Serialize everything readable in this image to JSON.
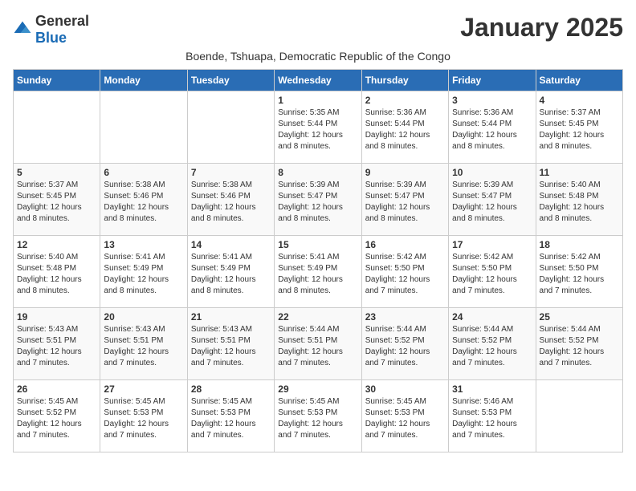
{
  "header": {
    "logo_general": "General",
    "logo_blue": "Blue",
    "month": "January 2025",
    "subtitle": "Boende, Tshuapa, Democratic Republic of the Congo"
  },
  "days_of_week": [
    "Sunday",
    "Monday",
    "Tuesday",
    "Wednesday",
    "Thursday",
    "Friday",
    "Saturday"
  ],
  "weeks": [
    [
      {
        "day": "",
        "info": ""
      },
      {
        "day": "",
        "info": ""
      },
      {
        "day": "",
        "info": ""
      },
      {
        "day": "1",
        "info": "Sunrise: 5:35 AM\nSunset: 5:44 PM\nDaylight: 12 hours\nand 8 minutes."
      },
      {
        "day": "2",
        "info": "Sunrise: 5:36 AM\nSunset: 5:44 PM\nDaylight: 12 hours\nand 8 minutes."
      },
      {
        "day": "3",
        "info": "Sunrise: 5:36 AM\nSunset: 5:44 PM\nDaylight: 12 hours\nand 8 minutes."
      },
      {
        "day": "4",
        "info": "Sunrise: 5:37 AM\nSunset: 5:45 PM\nDaylight: 12 hours\nand 8 minutes."
      }
    ],
    [
      {
        "day": "5",
        "info": "Sunrise: 5:37 AM\nSunset: 5:45 PM\nDaylight: 12 hours\nand 8 minutes."
      },
      {
        "day": "6",
        "info": "Sunrise: 5:38 AM\nSunset: 5:46 PM\nDaylight: 12 hours\nand 8 minutes."
      },
      {
        "day": "7",
        "info": "Sunrise: 5:38 AM\nSunset: 5:46 PM\nDaylight: 12 hours\nand 8 minutes."
      },
      {
        "day": "8",
        "info": "Sunrise: 5:39 AM\nSunset: 5:47 PM\nDaylight: 12 hours\nand 8 minutes."
      },
      {
        "day": "9",
        "info": "Sunrise: 5:39 AM\nSunset: 5:47 PM\nDaylight: 12 hours\nand 8 minutes."
      },
      {
        "day": "10",
        "info": "Sunrise: 5:39 AM\nSunset: 5:47 PM\nDaylight: 12 hours\nand 8 minutes."
      },
      {
        "day": "11",
        "info": "Sunrise: 5:40 AM\nSunset: 5:48 PM\nDaylight: 12 hours\nand 8 minutes."
      }
    ],
    [
      {
        "day": "12",
        "info": "Sunrise: 5:40 AM\nSunset: 5:48 PM\nDaylight: 12 hours\nand 8 minutes."
      },
      {
        "day": "13",
        "info": "Sunrise: 5:41 AM\nSunset: 5:49 PM\nDaylight: 12 hours\nand 8 minutes."
      },
      {
        "day": "14",
        "info": "Sunrise: 5:41 AM\nSunset: 5:49 PM\nDaylight: 12 hours\nand 8 minutes."
      },
      {
        "day": "15",
        "info": "Sunrise: 5:41 AM\nSunset: 5:49 PM\nDaylight: 12 hours\nand 8 minutes."
      },
      {
        "day": "16",
        "info": "Sunrise: 5:42 AM\nSunset: 5:50 PM\nDaylight: 12 hours\nand 7 minutes."
      },
      {
        "day": "17",
        "info": "Sunrise: 5:42 AM\nSunset: 5:50 PM\nDaylight: 12 hours\nand 7 minutes."
      },
      {
        "day": "18",
        "info": "Sunrise: 5:42 AM\nSunset: 5:50 PM\nDaylight: 12 hours\nand 7 minutes."
      }
    ],
    [
      {
        "day": "19",
        "info": "Sunrise: 5:43 AM\nSunset: 5:51 PM\nDaylight: 12 hours\nand 7 minutes."
      },
      {
        "day": "20",
        "info": "Sunrise: 5:43 AM\nSunset: 5:51 PM\nDaylight: 12 hours\nand 7 minutes."
      },
      {
        "day": "21",
        "info": "Sunrise: 5:43 AM\nSunset: 5:51 PM\nDaylight: 12 hours\nand 7 minutes."
      },
      {
        "day": "22",
        "info": "Sunrise: 5:44 AM\nSunset: 5:51 PM\nDaylight: 12 hours\nand 7 minutes."
      },
      {
        "day": "23",
        "info": "Sunrise: 5:44 AM\nSunset: 5:52 PM\nDaylight: 12 hours\nand 7 minutes."
      },
      {
        "day": "24",
        "info": "Sunrise: 5:44 AM\nSunset: 5:52 PM\nDaylight: 12 hours\nand 7 minutes."
      },
      {
        "day": "25",
        "info": "Sunrise: 5:44 AM\nSunset: 5:52 PM\nDaylight: 12 hours\nand 7 minutes."
      }
    ],
    [
      {
        "day": "26",
        "info": "Sunrise: 5:45 AM\nSunset: 5:52 PM\nDaylight: 12 hours\nand 7 minutes."
      },
      {
        "day": "27",
        "info": "Sunrise: 5:45 AM\nSunset: 5:53 PM\nDaylight: 12 hours\nand 7 minutes."
      },
      {
        "day": "28",
        "info": "Sunrise: 5:45 AM\nSunset: 5:53 PM\nDaylight: 12 hours\nand 7 minutes."
      },
      {
        "day": "29",
        "info": "Sunrise: 5:45 AM\nSunset: 5:53 PM\nDaylight: 12 hours\nand 7 minutes."
      },
      {
        "day": "30",
        "info": "Sunrise: 5:45 AM\nSunset: 5:53 PM\nDaylight: 12 hours\nand 7 minutes."
      },
      {
        "day": "31",
        "info": "Sunrise: 5:46 AM\nSunset: 5:53 PM\nDaylight: 12 hours\nand 7 minutes."
      },
      {
        "day": "",
        "info": ""
      }
    ]
  ]
}
